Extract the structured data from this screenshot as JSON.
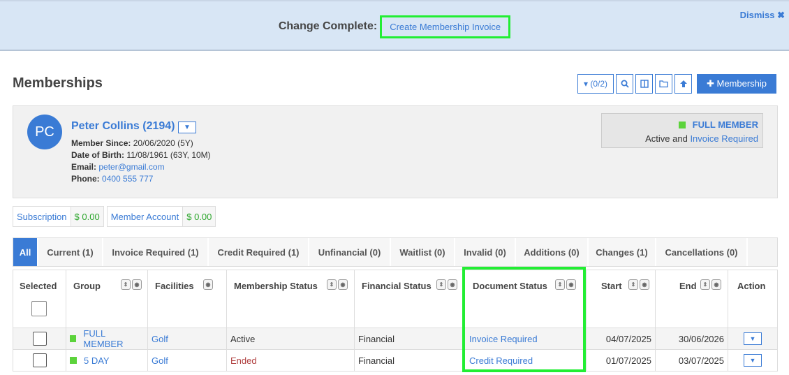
{
  "banner": {
    "label": "Change Complete:",
    "link": "Create Membership Invoice",
    "dismiss": "Dismiss ✖"
  },
  "page": {
    "title": "Memberships"
  },
  "toolbar": {
    "filter_label": "▾ (0/2)",
    "add_membership": "✚ Membership",
    "icons": [
      "search-icon",
      "columns-icon",
      "folder-icon",
      "upload-arrow-icon"
    ]
  },
  "member": {
    "initials": "PC",
    "name": "Peter Collins (2194)",
    "member_since_label": "Member Since:",
    "member_since": "20/06/2020 (5Y)",
    "dob_label": "Date of Birth:",
    "dob": "11/08/1961 (63Y, 10M)",
    "email_label": "Email:",
    "email": "peter@gmail.com",
    "phone_label": "Phone:",
    "phone": "0400 555 777",
    "type": "FULL MEMBER",
    "status_prefix": "Active and",
    "status_link": "Invoice Required"
  },
  "balances": [
    {
      "label": "Subscription",
      "value": "$ 0.00"
    },
    {
      "label": "Member Account",
      "value": "$ 0.00"
    }
  ],
  "tabs": [
    {
      "label": "All"
    },
    {
      "label": "Current (1)"
    },
    {
      "label": "Invoice Required (1)"
    },
    {
      "label": "Credit Required (1)"
    },
    {
      "label": "Unfinancial (0)"
    },
    {
      "label": "Waitlist (0)"
    },
    {
      "label": "Invalid (0)"
    },
    {
      "label": "Additions (0)"
    },
    {
      "label": "Changes (1)"
    },
    {
      "label": "Cancellations (0)"
    }
  ],
  "table": {
    "columns": [
      "Selected",
      "Group",
      "Facilities",
      "Membership Status",
      "Financial Status",
      "Document Status",
      "Start",
      "End",
      "Action"
    ],
    "rows": [
      {
        "group": "FULL MEMBER",
        "facility": "Golf",
        "membership_status": "Active",
        "financial_status": "Financial",
        "document_status": "Invoice Required",
        "start": "04/07/2025",
        "end": "30/06/2026"
      },
      {
        "group": "5 DAY",
        "facility": "Golf",
        "membership_status": "Ended",
        "financial_status": "Financial",
        "document_status": "Credit Required",
        "start": "01/07/2025",
        "end": "03/07/2025"
      }
    ]
  },
  "colors": {
    "accent": "#3a7bd5",
    "highlight": "#22ee33",
    "group_marker": "#5cd33b",
    "ended": "#b04040"
  }
}
